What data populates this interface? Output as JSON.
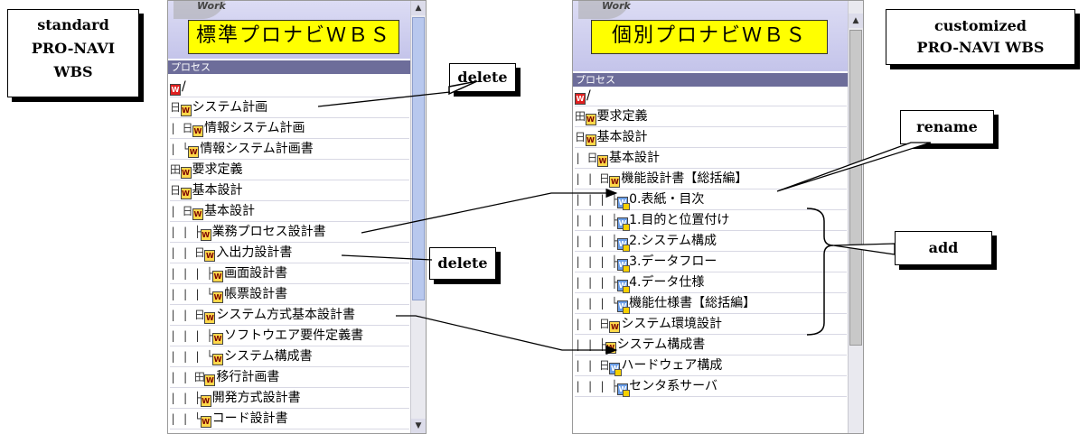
{
  "left_panel": {
    "worklabel": "Work",
    "title": "標準プロナビＷＢＳ",
    "section": "プロセス",
    "rows": [
      {
        "prefix": "",
        "icon": "root",
        "label": "/"
      },
      {
        "prefix": "日",
        "icon": "doc",
        "label": "システム計画"
      },
      {
        "prefix": "| 日",
        "icon": "doc",
        "label": "情報システム計画"
      },
      {
        "prefix": "|   └",
        "icon": "doc",
        "label": "情報システム計画書"
      },
      {
        "prefix": "田",
        "icon": "doc",
        "label": "要求定義"
      },
      {
        "prefix": "日",
        "icon": "doc",
        "label": "基本設計"
      },
      {
        "prefix": "| 日",
        "icon": "doc",
        "label": "基本設計"
      },
      {
        "prefix": "| | ├",
        "icon": "doc",
        "label": "業務プロセス設計書"
      },
      {
        "prefix": "| | 日",
        "icon": "doc",
        "label": "入出力設計書"
      },
      {
        "prefix": "| | | ├",
        "icon": "doc",
        "label": "画面設計書"
      },
      {
        "prefix": "| | | └",
        "icon": "doc",
        "label": "帳票設計書"
      },
      {
        "prefix": "| | 日",
        "icon": "doc",
        "label": "システム方式基本設計書"
      },
      {
        "prefix": "| | | ├",
        "icon": "doc",
        "label": "ソフトウエア要件定義書"
      },
      {
        "prefix": "| | | └",
        "icon": "doc",
        "label": "システム構成書"
      },
      {
        "prefix": "| | 田",
        "icon": "doc",
        "label": "移行計画書"
      },
      {
        "prefix": "| | ├",
        "icon": "doc",
        "label": "開発方式設計書"
      },
      {
        "prefix": "| | └",
        "icon": "doc",
        "label": "コード設計書"
      }
    ]
  },
  "right_panel": {
    "worklabel": "Work",
    "title": "個別プロナビＷＢＳ",
    "section": "プロセス",
    "rows": [
      {
        "prefix": "",
        "icon": "root",
        "label": "/"
      },
      {
        "prefix": "田",
        "icon": "doc",
        "label": "要求定義"
      },
      {
        "prefix": "日",
        "icon": "doc",
        "label": "基本設計"
      },
      {
        "prefix": "| 日",
        "icon": "doc",
        "label": "基本設計"
      },
      {
        "prefix": "| | 日",
        "icon": "doc",
        "label": "機能設計書【総括編】"
      },
      {
        "prefix": "| | | ├",
        "icon": "plus",
        "label": "0.表紙・目次"
      },
      {
        "prefix": "| | | ├",
        "icon": "plus",
        "label": "1.目的と位置付け"
      },
      {
        "prefix": "| | | ├",
        "icon": "plus",
        "label": "2.システム構成"
      },
      {
        "prefix": "| | | ├",
        "icon": "plus",
        "label": "3.データフロー"
      },
      {
        "prefix": "| | | ├",
        "icon": "plus",
        "label": "4.データ仕様"
      },
      {
        "prefix": "| | | └",
        "icon": "plus",
        "label": "機能仕様書【総括編】"
      },
      {
        "prefix": "| | 日",
        "icon": "doc",
        "label": "システム環境設計"
      },
      {
        "prefix": "| |   ├",
        "icon": "doc",
        "label": "システム構成書"
      },
      {
        "prefix": "| |   日",
        "icon": "plus",
        "label": "ハードウェア構成"
      },
      {
        "prefix": "| |   | ├",
        "icon": "plus",
        "label": "センタ系サーバ"
      }
    ]
  },
  "callouts": {
    "standard": [
      "standard",
      "PRO-NAVI",
      "WBS"
    ],
    "customized": [
      "customized",
      "PRO-NAVI WBS"
    ],
    "delete1": "delete",
    "delete2": "delete",
    "rename": "rename",
    "add": "add"
  },
  "icons": {
    "root": "red-w-icon",
    "doc": "yellow-w-document-icon",
    "plus": "blue-w-added-icon"
  }
}
